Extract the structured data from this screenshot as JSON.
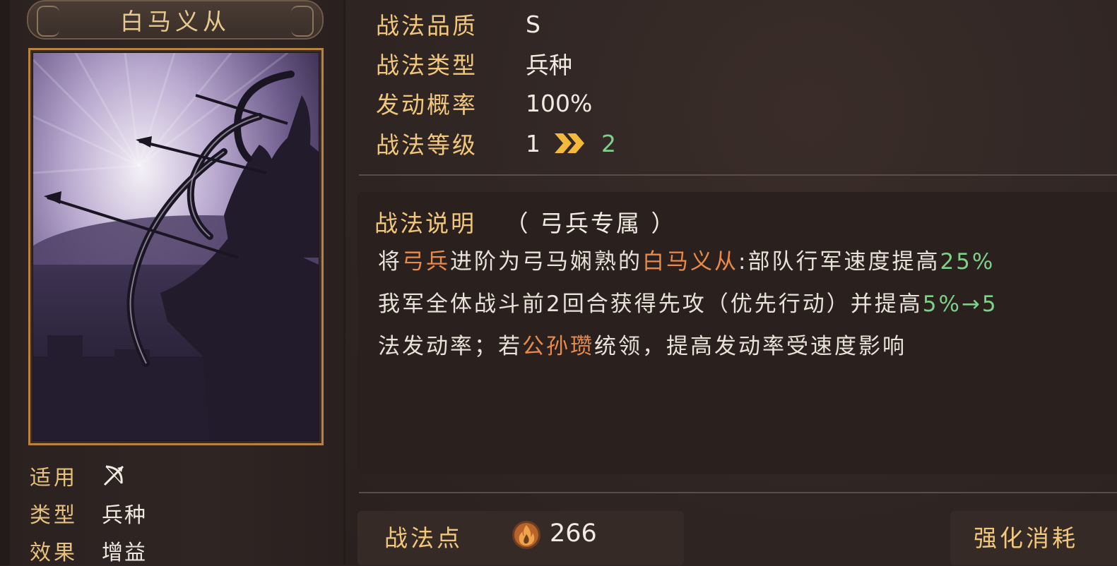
{
  "skill": {
    "name": "白马义从"
  },
  "card_meta": {
    "apply_label": "适用",
    "apply_icon": "bow-arrow-icon",
    "type_label": "类型",
    "type_value": "兵种",
    "effect_label": "效果",
    "effect_value": "增益"
  },
  "info": {
    "quality_label": "战法品质",
    "quality_value": "S",
    "type_label": "战法类型",
    "type_value": "兵种",
    "rate_label": "发动概率",
    "rate_value": "100%",
    "level_label": "战法等级",
    "level_from": "1",
    "level_arrow_icon": "double-chevron-right-icon",
    "level_to": "2"
  },
  "description": {
    "title": "战法说明",
    "subtitle": "（ 弓兵专属 ）",
    "line1": {
      "p1": "将",
      "h1": "弓兵",
      "p2": "进阶为弓马娴熟的",
      "h2": "白马义从",
      "p3": ":部队行军速度提高",
      "g1": "25%"
    },
    "line2": {
      "p1": "我军全体战斗前2回合获得先攻（优先行动）并提高",
      "g1": "5%→5"
    },
    "line3": {
      "p1": "法发动率；若",
      "h1": "公孙瓒",
      "p2": "统领，提高发动率受速度影响"
    }
  },
  "footer": {
    "points_label": "战法点",
    "points_icon": "fire-icon",
    "points_value": "266",
    "enhance_label": "强化消耗"
  },
  "colors": {
    "gold_label": "#f0c77d",
    "highlight_orange": "#ea8a4a",
    "highlight_green": "#7fcf8a",
    "card_border": "#b8823f",
    "background": "#2e2422"
  }
}
